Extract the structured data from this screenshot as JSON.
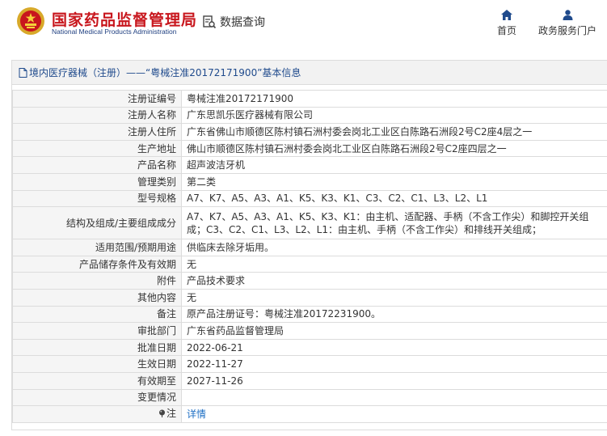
{
  "header": {
    "brand_cn": "国家药品监督管理局",
    "brand_en": "National Medical Products Administration",
    "data_query": "数据查询",
    "nav": [
      {
        "label": "首页",
        "icon": "home-icon"
      },
      {
        "label": "政务服务门户",
        "icon": "user-icon"
      }
    ]
  },
  "panel": {
    "title": "境内医疗器械（注册）——“粤械注准20172171900”基本信息",
    "icon": "document-icon"
  },
  "rows": [
    {
      "label": "注册证编号",
      "value": "粤械注准20172171900"
    },
    {
      "label": "注册人名称",
      "value": "广东思凯乐医疗器械有限公司"
    },
    {
      "label": "注册人住所",
      "value": "广东省佛山市顺德区陈村镇石洲村委会岗北工业区白陈路石洲段2号C2座4层之一"
    },
    {
      "label": "生产地址",
      "value": "佛山市顺德区陈村镇石洲村委会岗北工业区白陈路石洲段2号C2座四层之一"
    },
    {
      "label": "产品名称",
      "value": "超声波洁牙机"
    },
    {
      "label": "管理类别",
      "value": "第二类"
    },
    {
      "label": "型号规格",
      "value": "A7、K7、A5、A3、A1、K5、K3、K1、C3、C2、C1、L3、L2、L1"
    },
    {
      "label": "结构及组成/主要组成成分",
      "value": "A7、K7、A5、A3、A1、K5、K3、K1：由主机、适配器、手柄（不含工作尖）和脚控开关组成；C3、C2、C1、L3、L2、L1：由主机、手柄（不含工作尖）和排线开关组成；"
    },
    {
      "label": "适用范围/预期用途",
      "value": "供临床去除牙垢用。"
    },
    {
      "label": "产品储存条件及有效期",
      "value": "无"
    },
    {
      "label": "附件",
      "value": "产品技术要求"
    },
    {
      "label": "其他内容",
      "value": "无"
    },
    {
      "label": "备注",
      "value": "原产品注册证号：粤械注准20172231900。"
    },
    {
      "label": "审批部门",
      "value": "广东省药品监督管理局"
    },
    {
      "label": "批准日期",
      "value": "2022-06-21"
    },
    {
      "label": "生效日期",
      "value": "2022-11-27"
    },
    {
      "label": "有效期至",
      "value": "2027-11-26"
    },
    {
      "label": "变更情况",
      "value": ""
    },
    {
      "label": "注",
      "value": "详情"
    }
  ]
}
